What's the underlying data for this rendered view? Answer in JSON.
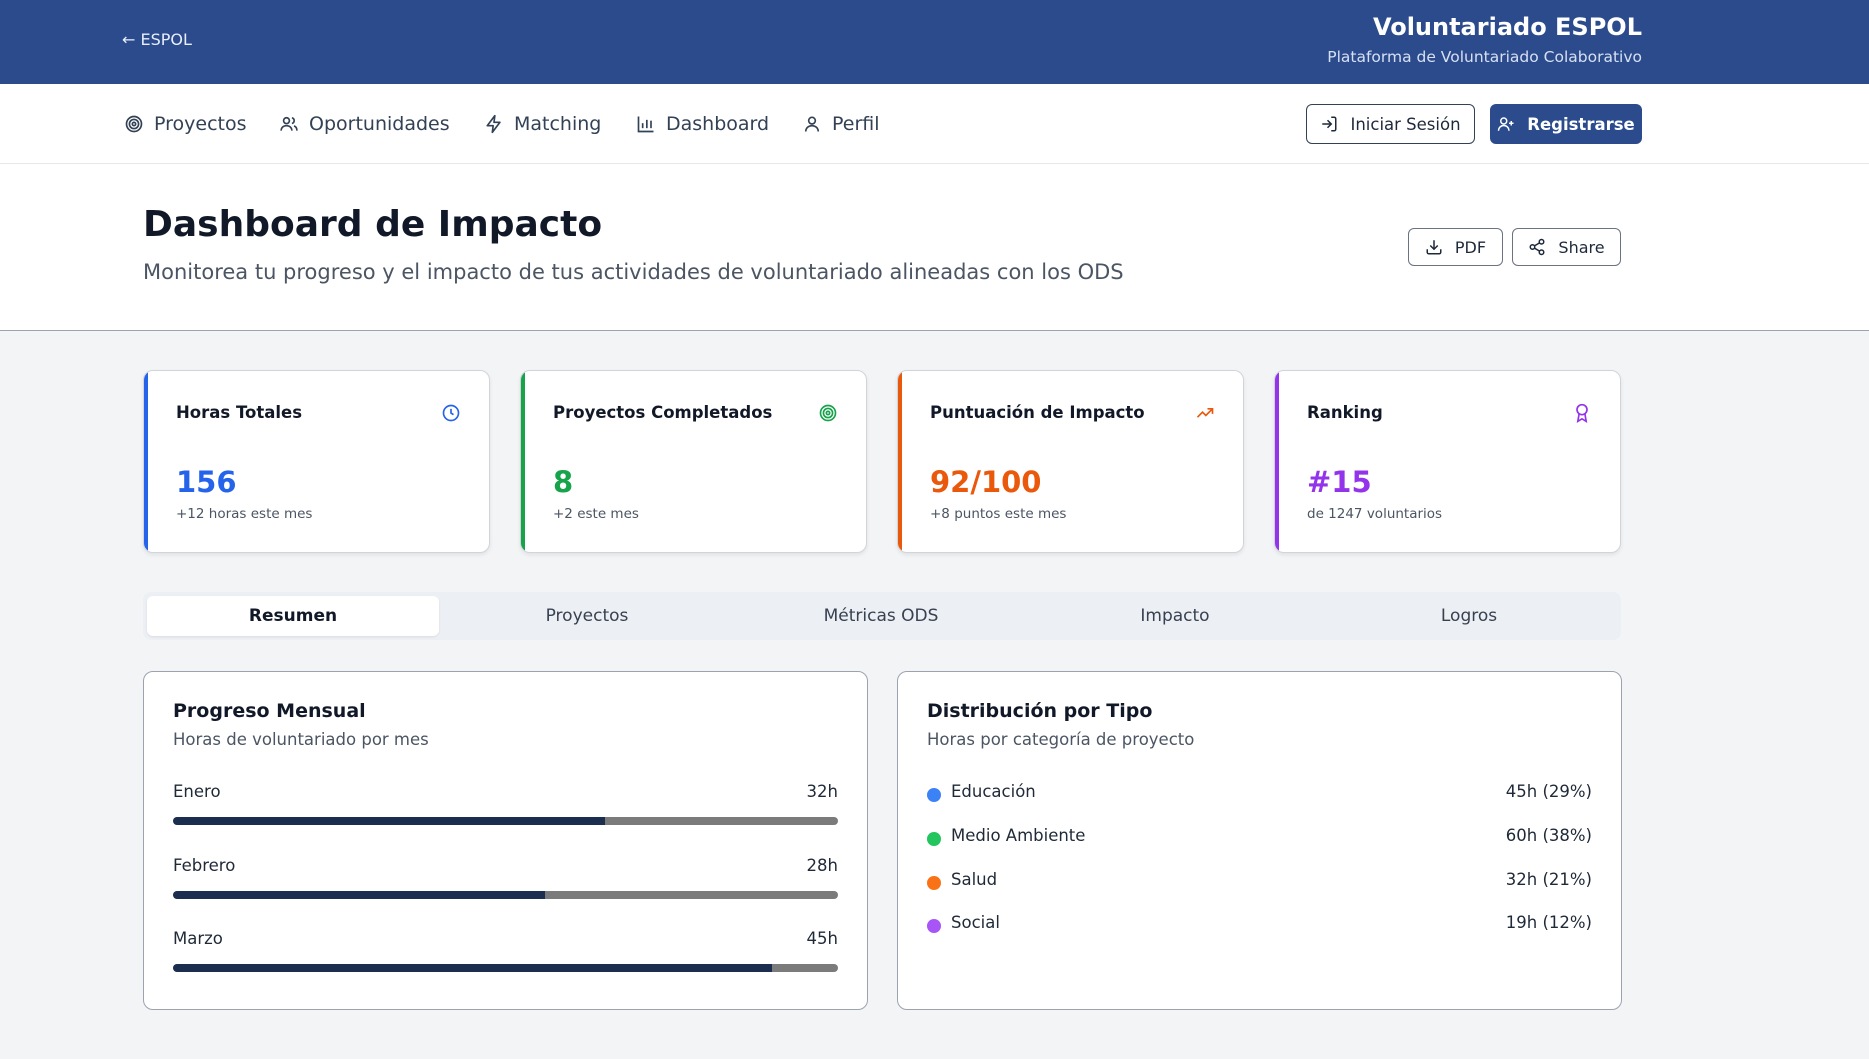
{
  "topbar": {
    "back_label": "← ESPOL",
    "brand_title": "Voluntariado ESPOL",
    "brand_subtitle": "Plataforma de Voluntariado Colaborativo"
  },
  "nav": {
    "items": [
      {
        "label": "Proyectos",
        "icon": "target-icon"
      },
      {
        "label": "Oportunidades",
        "icon": "users-icon"
      },
      {
        "label": "Matching",
        "icon": "lightning-icon"
      },
      {
        "label": "Dashboard",
        "icon": "bar-chart-icon"
      },
      {
        "label": "Perfil",
        "icon": "user-icon"
      }
    ],
    "login_label": "Iniciar Sesión",
    "register_label": "Registrarse"
  },
  "header": {
    "title": "Dashboard de Impacto",
    "subtitle": "Monitorea tu progreso y el impacto de tus actividades de voluntariado alineadas con los ODS",
    "pdf_label": "PDF",
    "share_label": "Share"
  },
  "stats": [
    {
      "label": "Horas Totales",
      "value": "156",
      "note": "+12 horas este mes",
      "color": "#2563eb",
      "icon": "clock-icon"
    },
    {
      "label": "Proyectos Completados",
      "value": "8",
      "note": "+2 este mes",
      "color": "#16a34a",
      "icon": "target-icon"
    },
    {
      "label": "Puntuación de Impacto",
      "value": "92/100",
      "note": "+8 puntos este mes",
      "color": "#ea580c",
      "icon": "trending-up-icon"
    },
    {
      "label": "Ranking",
      "value": "#15",
      "note": "de 1247 voluntarios",
      "color": "#9333ea",
      "icon": "award-icon"
    }
  ],
  "tabs": [
    "Resumen",
    "Proyectos",
    "Métricas ODS",
    "Impacto",
    "Logros"
  ],
  "active_tab": "Resumen",
  "monthly": {
    "title": "Progreso Mensual",
    "subtitle": "Horas de voluntariado por mes",
    "months": [
      {
        "name": "Enero",
        "hours": "32h",
        "progress": 0.65
      },
      {
        "name": "Febrero",
        "hours": "28h",
        "progress": 0.56
      },
      {
        "name": "Marzo",
        "hours": "45h",
        "progress": 0.9
      }
    ]
  },
  "distribution": {
    "title": "Distribución por Tipo",
    "subtitle": "Horas por categoría de proyecto",
    "items": [
      {
        "name": "Educación",
        "value": "45h (29%)",
        "color": "#3b82f6"
      },
      {
        "name": "Medio Ambiente",
        "value": "60h (38%)",
        "color": "#22c55e"
      },
      {
        "name": "Salud",
        "value": "32h (21%)",
        "color": "#f97316"
      },
      {
        "name": "Social",
        "value": "19h (12%)",
        "color": "#a855f7"
      }
    ]
  }
}
